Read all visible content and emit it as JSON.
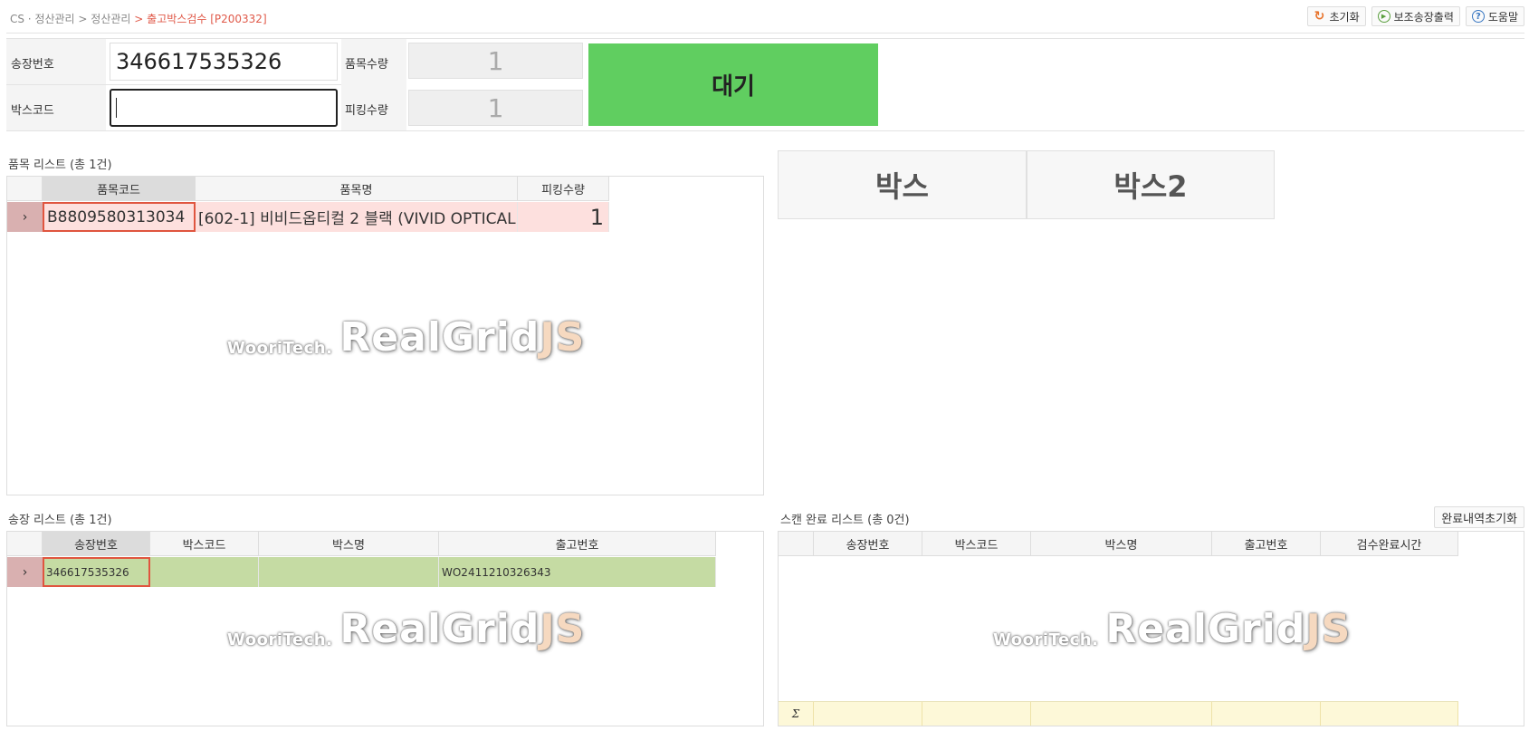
{
  "breadcrumb": {
    "part1": "CS · 정산관리",
    "sep1": " > ",
    "part2": "정산관리",
    "sep2": " > ",
    "current": "출고박스검수 [P200332]"
  },
  "toolbar": {
    "reset_label": "초기화",
    "print_label": "보조송장출력",
    "help_label": "도움말",
    "reset_icon": "refresh-icon",
    "print_icon": "play-icon",
    "help_icon": "question-icon"
  },
  "form": {
    "invoice_label": "송장번호",
    "invoice_value": "346617535326",
    "boxcode_label": "박스코드",
    "boxcode_value": "",
    "item_qty_label": "품목수량",
    "item_qty_value": "1",
    "picking_qty_label": "피킹수량",
    "picking_qty_value": "1",
    "status_text": "대기",
    "status_color": "#60ce60"
  },
  "item_list": {
    "title": "품목 리스트 (총 1건)",
    "columns": [
      "품목코드",
      "품목명",
      "피킹수량"
    ],
    "rows": [
      {
        "code": "B8809580313034",
        "name": "[602-1] 비비드옵티컬 2 블랙 (VIVID OPTICAL",
        "qty": "1"
      }
    ]
  },
  "box_buttons": [
    "박스",
    "박스2"
  ],
  "invoice_list": {
    "title": "송장 리스트 (총 1건)",
    "columns": [
      "송장번호",
      "박스코드",
      "박스명",
      "출고번호"
    ],
    "rows": [
      {
        "invoice": "346617535326",
        "boxcode": "",
        "boxname": "",
        "release": "WO2411210326343"
      }
    ]
  },
  "scan_list": {
    "title": "스캔 완료 리스트 (총 0건)",
    "clear_label": "완료내역초기화",
    "columns": [
      "송장번호",
      "박스코드",
      "박스명",
      "출고번호",
      "검수완료시간"
    ],
    "footer_symbol": "Σ"
  },
  "watermark": {
    "small": "WooriTech.",
    "big_main": "RealGrid",
    "big_suffix": "JS"
  },
  "colors": {
    "accent_red": "#e05a4a",
    "selected_row_pink": "#fde0de",
    "selected_row_green": "#c5dba3",
    "row_indicator": "#d9b0b0"
  }
}
